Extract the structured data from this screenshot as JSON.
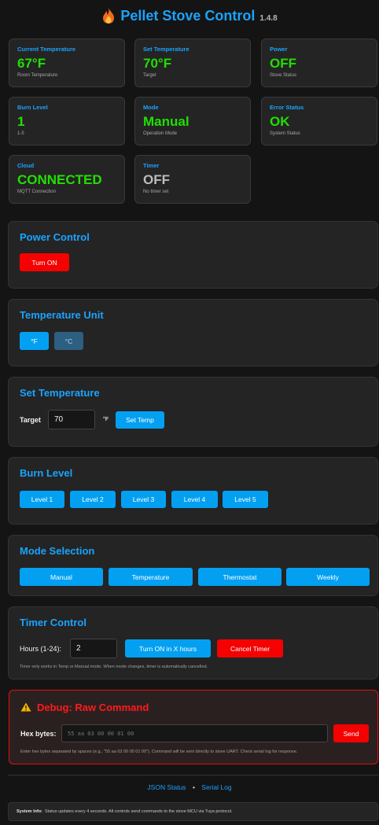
{
  "header": {
    "title": "Pellet Stove Control",
    "version": "1.4.8",
    "icon": "fire-icon"
  },
  "cards": [
    {
      "label": "Current Temperature",
      "value": "67°F",
      "sub": "Room Temperature"
    },
    {
      "label": "Set Temperature",
      "value": "70°F",
      "sub": "Target"
    },
    {
      "label": "Power",
      "value": "OFF",
      "sub": "Stove Status"
    },
    {
      "label": "Burn Level",
      "value": "1",
      "sub": "1-5"
    },
    {
      "label": "Mode",
      "value": "Manual",
      "sub": "Operation Mode"
    },
    {
      "label": "Error Status",
      "value": "OK",
      "sub": "System Status"
    },
    {
      "label": "Cloud",
      "value": "CONNECTED",
      "sub": "MQTT Connection"
    },
    {
      "label": "Timer",
      "value": "OFF",
      "sub": "No timer set"
    }
  ],
  "power": {
    "title": "Power Control",
    "button": "Turn ON"
  },
  "unit": {
    "title": "Temperature Unit",
    "f": "°F",
    "c": "°C"
  },
  "set_temp": {
    "title": "Set Temperature",
    "label": "Target",
    "value": "70",
    "unit": "°F",
    "button": "Set Temp"
  },
  "burn": {
    "title": "Burn Level",
    "levels": [
      "Level 1",
      "Level 2",
      "Level 3",
      "Level 4",
      "Level 5"
    ]
  },
  "mode": {
    "title": "Mode Selection",
    "options": [
      "Manual",
      "Temperature",
      "Thermostat",
      "Weekly"
    ]
  },
  "timer": {
    "title": "Timer Control",
    "label": "Hours (1-24):",
    "value": "2",
    "on_button": "Turn ON in X hours",
    "cancel_button": "Cancel Timer",
    "note": "Timer only works in Temp or Manual mode. When mode changes, timer is automatically cancelled."
  },
  "debug": {
    "title": "Debug: Raw Command",
    "label": "Hex bytes:",
    "placeholder": "55 aa 03 00 00 01 00",
    "button": "Send",
    "note": "Enter hex bytes separated by spaces (e.g., \"55 aa 03 00 00 01 00\"). Command will be sent directly to stove UART. Check serial log for response."
  },
  "footer": {
    "link1": "JSON Status",
    "sep": "•",
    "link2": "Serial Log"
  },
  "sysinfo": {
    "label": "System Info:",
    "text": "Status updates every 4 seconds. All controls send commands to the stove MCU via Tuya protocol."
  },
  "colors": {
    "accent": "#1aa3ff",
    "ok_green": "#21e000",
    "danger": "#f40101",
    "button": "#03a0f2"
  }
}
